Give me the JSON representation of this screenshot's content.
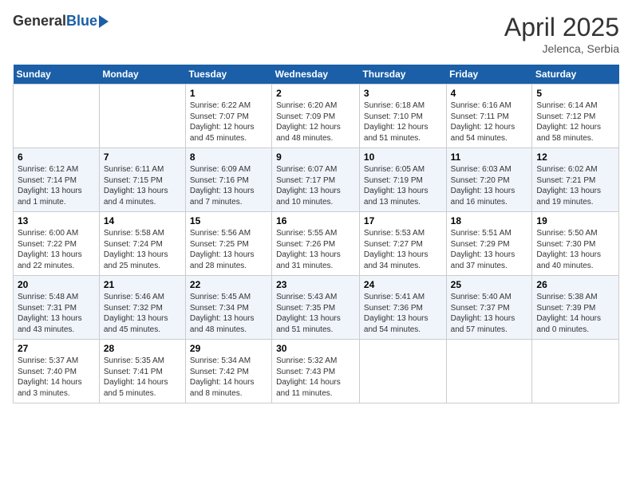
{
  "header": {
    "logo_general": "General",
    "logo_blue": "Blue",
    "month": "April 2025",
    "location": "Jelenca, Serbia"
  },
  "days_of_week": [
    "Sunday",
    "Monday",
    "Tuesday",
    "Wednesday",
    "Thursday",
    "Friday",
    "Saturday"
  ],
  "weeks": [
    [
      {
        "day": "",
        "info": ""
      },
      {
        "day": "",
        "info": ""
      },
      {
        "day": "1",
        "info": "Sunrise: 6:22 AM\nSunset: 7:07 PM\nDaylight: 12 hours\nand 45 minutes."
      },
      {
        "day": "2",
        "info": "Sunrise: 6:20 AM\nSunset: 7:09 PM\nDaylight: 12 hours\nand 48 minutes."
      },
      {
        "day": "3",
        "info": "Sunrise: 6:18 AM\nSunset: 7:10 PM\nDaylight: 12 hours\nand 51 minutes."
      },
      {
        "day": "4",
        "info": "Sunrise: 6:16 AM\nSunset: 7:11 PM\nDaylight: 12 hours\nand 54 minutes."
      },
      {
        "day": "5",
        "info": "Sunrise: 6:14 AM\nSunset: 7:12 PM\nDaylight: 12 hours\nand 58 minutes."
      }
    ],
    [
      {
        "day": "6",
        "info": "Sunrise: 6:12 AM\nSunset: 7:14 PM\nDaylight: 13 hours\nand 1 minute."
      },
      {
        "day": "7",
        "info": "Sunrise: 6:11 AM\nSunset: 7:15 PM\nDaylight: 13 hours\nand 4 minutes."
      },
      {
        "day": "8",
        "info": "Sunrise: 6:09 AM\nSunset: 7:16 PM\nDaylight: 13 hours\nand 7 minutes."
      },
      {
        "day": "9",
        "info": "Sunrise: 6:07 AM\nSunset: 7:17 PM\nDaylight: 13 hours\nand 10 minutes."
      },
      {
        "day": "10",
        "info": "Sunrise: 6:05 AM\nSunset: 7:19 PM\nDaylight: 13 hours\nand 13 minutes."
      },
      {
        "day": "11",
        "info": "Sunrise: 6:03 AM\nSunset: 7:20 PM\nDaylight: 13 hours\nand 16 minutes."
      },
      {
        "day": "12",
        "info": "Sunrise: 6:02 AM\nSunset: 7:21 PM\nDaylight: 13 hours\nand 19 minutes."
      }
    ],
    [
      {
        "day": "13",
        "info": "Sunrise: 6:00 AM\nSunset: 7:22 PM\nDaylight: 13 hours\nand 22 minutes."
      },
      {
        "day": "14",
        "info": "Sunrise: 5:58 AM\nSunset: 7:24 PM\nDaylight: 13 hours\nand 25 minutes."
      },
      {
        "day": "15",
        "info": "Sunrise: 5:56 AM\nSunset: 7:25 PM\nDaylight: 13 hours\nand 28 minutes."
      },
      {
        "day": "16",
        "info": "Sunrise: 5:55 AM\nSunset: 7:26 PM\nDaylight: 13 hours\nand 31 minutes."
      },
      {
        "day": "17",
        "info": "Sunrise: 5:53 AM\nSunset: 7:27 PM\nDaylight: 13 hours\nand 34 minutes."
      },
      {
        "day": "18",
        "info": "Sunrise: 5:51 AM\nSunset: 7:29 PM\nDaylight: 13 hours\nand 37 minutes."
      },
      {
        "day": "19",
        "info": "Sunrise: 5:50 AM\nSunset: 7:30 PM\nDaylight: 13 hours\nand 40 minutes."
      }
    ],
    [
      {
        "day": "20",
        "info": "Sunrise: 5:48 AM\nSunset: 7:31 PM\nDaylight: 13 hours\nand 43 minutes."
      },
      {
        "day": "21",
        "info": "Sunrise: 5:46 AM\nSunset: 7:32 PM\nDaylight: 13 hours\nand 45 minutes."
      },
      {
        "day": "22",
        "info": "Sunrise: 5:45 AM\nSunset: 7:34 PM\nDaylight: 13 hours\nand 48 minutes."
      },
      {
        "day": "23",
        "info": "Sunrise: 5:43 AM\nSunset: 7:35 PM\nDaylight: 13 hours\nand 51 minutes."
      },
      {
        "day": "24",
        "info": "Sunrise: 5:41 AM\nSunset: 7:36 PM\nDaylight: 13 hours\nand 54 minutes."
      },
      {
        "day": "25",
        "info": "Sunrise: 5:40 AM\nSunset: 7:37 PM\nDaylight: 13 hours\nand 57 minutes."
      },
      {
        "day": "26",
        "info": "Sunrise: 5:38 AM\nSunset: 7:39 PM\nDaylight: 14 hours\nand 0 minutes."
      }
    ],
    [
      {
        "day": "27",
        "info": "Sunrise: 5:37 AM\nSunset: 7:40 PM\nDaylight: 14 hours\nand 3 minutes."
      },
      {
        "day": "28",
        "info": "Sunrise: 5:35 AM\nSunset: 7:41 PM\nDaylight: 14 hours\nand 5 minutes."
      },
      {
        "day": "29",
        "info": "Sunrise: 5:34 AM\nSunset: 7:42 PM\nDaylight: 14 hours\nand 8 minutes."
      },
      {
        "day": "30",
        "info": "Sunrise: 5:32 AM\nSunset: 7:43 PM\nDaylight: 14 hours\nand 11 minutes."
      },
      {
        "day": "",
        "info": ""
      },
      {
        "day": "",
        "info": ""
      },
      {
        "day": "",
        "info": ""
      }
    ]
  ]
}
